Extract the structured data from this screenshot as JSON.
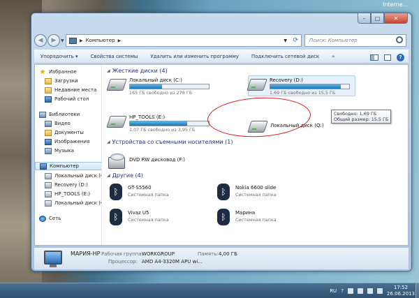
{
  "desktop": {
    "title_fragment": "Interne..."
  },
  "window": {
    "caption_buttons": {
      "minimize": "–",
      "maximize": "□",
      "close": "✕"
    },
    "address": {
      "path": "Компьютер"
    },
    "search": {
      "placeholder": "Поиск: Компьютер"
    },
    "toolbar": {
      "organize": "Упорядочить ▾",
      "system_properties": "Свойства системы",
      "uninstall": "Удалить или изменить программу",
      "map_drive": "Подключить сетевой диск",
      "more": "»"
    },
    "sidebar": {
      "favorites": "Избранное",
      "downloads": "Загрузки",
      "recent": "Недавние места",
      "desktop": "Рабочий стол",
      "libraries": "Библиотеки",
      "video": "Видео",
      "documents": "Документы",
      "images": "Изображения",
      "music": "Музыка",
      "computer": "Компьютер",
      "drive_c": "Локальный диск (C",
      "drive_d": "Recovery (D:)",
      "drive_e": "HP_TOOLS (E:)",
      "drive_q": "Локальный диск (Q",
      "network": "Сеть"
    },
    "groups": {
      "hard_disks": "Жесткие диски (4)",
      "removable": "Устройства со съемными носителями (1)",
      "other": "Другие (4)"
    },
    "drives": [
      {
        "name": "Локальный диск (C:)",
        "free": "165 ГБ свободно из 278 ГБ",
        "used_fraction": 0.41
      },
      {
        "name": "Recovery (D:)",
        "free": "1,69 ГБ свободно из 15,5 ГБ",
        "used_fraction": 0.89
      },
      {
        "name": "HP_TOOLS (E:)",
        "free": "1,07 ГБ свободно из 3,95 ГБ",
        "used_fraction": 0.73
      },
      {
        "name": "Локальный диск (Q:)"
      }
    ],
    "tooltip": {
      "line1": "Свободно: 1,69 ГБ",
      "line2": "Общий размер: 15,5 ГБ"
    },
    "removable": [
      {
        "name": "DVD RW дисковод (F:)"
      }
    ],
    "other": [
      {
        "name": "GT-S5560",
        "type": "Системная папка"
      },
      {
        "name": "Nokia 6600 slide",
        "type": "Системная папка"
      },
      {
        "name": "Vivaz U5",
        "type": "Системная папка"
      },
      {
        "name": "Марина",
        "type": "Системная папка"
      }
    ],
    "details": {
      "name": "МАРИЯ-HP",
      "workgroup_label": "Рабочая группа:",
      "workgroup": "WORKGROUP",
      "memory_label": "Память:",
      "memory": "4,00 ГБ",
      "processor_label": "Процессор:",
      "processor": "AMD A4-3320M APU wi..."
    }
  },
  "taskbar": {
    "lang": "RU",
    "time": "17:52",
    "date": "26.06.2013"
  }
}
